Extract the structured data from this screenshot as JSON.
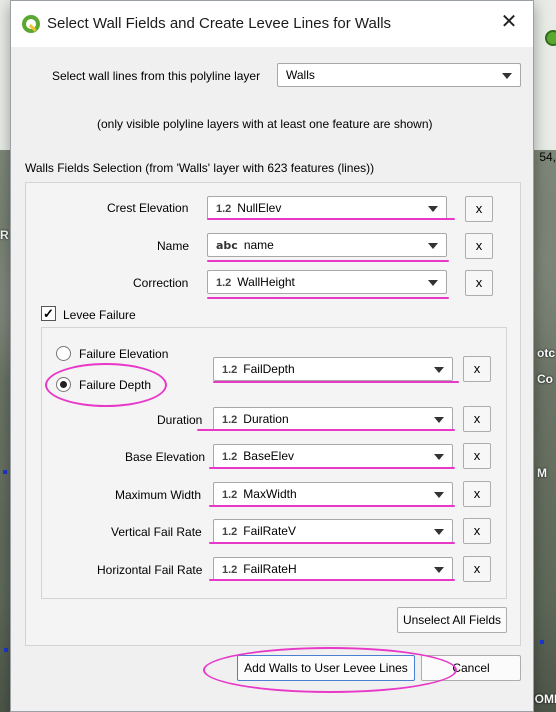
{
  "dialog": {
    "title": "Select Wall Fields and Create Levee Lines for Walls",
    "layer_label": "Select wall lines from this polyline layer",
    "layer_value": "Walls",
    "layer_note": "(only visible polyline layers with at least one feature are shown)",
    "section_label": "Walls Fields Selection (from 'Walls' layer with 623 features (lines))",
    "close_glyph": "✕"
  },
  "fields": [
    {
      "label": "Crest Elevation",
      "type": "1.2",
      "value": "NullElev"
    },
    {
      "label": "Name",
      "type": "abc",
      "value": "name"
    },
    {
      "label": "Correction",
      "type": "1.2",
      "value": "WallHeight"
    }
  ],
  "levee_failure": {
    "checkbox_label": "Levee Failure",
    "checked": true,
    "radio_elevation": "Failure Elevation",
    "radio_depth": "Failure Depth",
    "selected": "Failure Depth",
    "depth_type": "1.2",
    "depth_value": "FailDepth",
    "rows": [
      {
        "label": "Duration",
        "type": "1.2",
        "value": "Duration"
      },
      {
        "label": "Base Elevation",
        "type": "1.2",
        "value": "BaseElev"
      },
      {
        "label": "Maximum Width",
        "type": "1.2",
        "value": "MaxWidth"
      },
      {
        "label": "Vertical Fail Rate",
        "type": "1.2",
        "value": "FailRateV"
      },
      {
        "label": "Horizontal Fail Rate",
        "type": "1.2",
        "value": "FailRateH"
      }
    ]
  },
  "buttons": {
    "clear": "x",
    "unselect_all": "Unselect All Fields",
    "add": "Add Walls to User Levee Lines",
    "cancel": "Cancel"
  },
  "map_fragments": {
    "coord": "54,",
    "frag_r": "R",
    "frag_otc": "otc",
    "frag_co": "Co",
    "frag_m": "M",
    "frag_ondomi": "ONDOMI"
  },
  "colors": {
    "highlight": "#e838c8",
    "dialog_bg": "#f0f0f0"
  }
}
